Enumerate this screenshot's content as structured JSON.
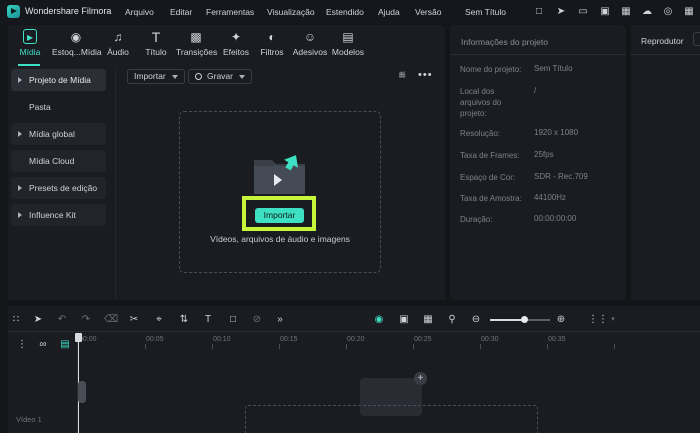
{
  "app": {
    "name": "Wondershare Filmora",
    "project_title": "Sem Título",
    "menu": [
      "Arquivo",
      "Editar",
      "Ferramentas",
      "Visualização",
      "Estendido",
      "Ajuda",
      "Versão"
    ],
    "title_icons": [
      "gift-icon",
      "send-icon",
      "monitor-icon",
      "image-icon",
      "save-icon",
      "cloud-upload-icon",
      "headset-icon",
      "grid-icon"
    ]
  },
  "media_tabs": [
    {
      "label": "Mídia",
      "icon": "media-icon",
      "active": true
    },
    {
      "label": "Estoq...Mídia",
      "icon": "stock-media-icon"
    },
    {
      "label": "Áudio",
      "icon": "audio-icon"
    },
    {
      "label": "Título",
      "icon": "title-icon"
    },
    {
      "label": "Transições",
      "icon": "transitions-icon"
    },
    {
      "label": "Efeitos",
      "icon": "effects-icon"
    },
    {
      "label": "Filtros",
      "icon": "filters-icon"
    },
    {
      "label": "Adesivos",
      "icon": "stickers-icon"
    },
    {
      "label": "Modelos",
      "icon": "templates-icon"
    }
  ],
  "sidebar": {
    "items": [
      {
        "label": "Projeto de Mídia",
        "caret": true,
        "active": true
      },
      {
        "label": "Pasta",
        "caret": false
      },
      {
        "label": "Mídia global",
        "caret": true
      },
      {
        "label": "Mídia Cloud",
        "caret": false
      },
      {
        "label": "Presets de edição",
        "caret": true
      },
      {
        "label": "Influence Kit",
        "caret": true
      }
    ]
  },
  "media_toolbar": {
    "import_label": "Importar",
    "record_label": "Gravar"
  },
  "dropzone": {
    "import_button": "Importar",
    "hint": "Vídeos, arquivos de áudio e imagens",
    "highlight_color": "#c6f53a"
  },
  "project_info": {
    "title": "Informações do projeto",
    "rows": [
      {
        "label": "Nome do projeto:",
        "value": "Sem Título"
      },
      {
        "label": "Local dos arquivos do projeto:",
        "value": "/"
      },
      {
        "label": "Resolução:",
        "value": "1920 x 1080"
      },
      {
        "label": "Taxa de Frames:",
        "value": "25fps"
      },
      {
        "label": "Espaço de Cor:",
        "value": "SDR - Rec.709"
      },
      {
        "label": "Taxa de Amostra:",
        "value": "44100Hz"
      },
      {
        "label": "Duração:",
        "value": "00:00:00:00"
      }
    ]
  },
  "player": {
    "title": "Reprodutor"
  },
  "timeline": {
    "ruler": [
      "00:00",
      "00:05",
      "00:10",
      "00:15",
      "00:20",
      "00:25",
      "00:30",
      "00:35"
    ],
    "track_label": "Vídeo 1",
    "zoom_level": 0.57
  },
  "colors": {
    "accent": "#3ee0c4",
    "highlight": "#c6f53a",
    "background": "#141519",
    "panel": "#1b1c21"
  }
}
